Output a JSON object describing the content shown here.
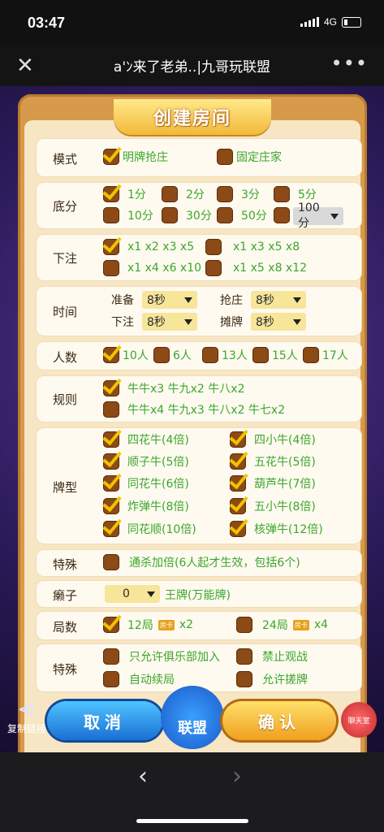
{
  "status": {
    "time": "03:47",
    "network": "4G"
  },
  "nav": {
    "close": "✕",
    "title": "a'ﾝ来了老弟..|九哥玩联盟",
    "more": "•••"
  },
  "dialog_title": "创建房间",
  "mode": {
    "label": "模式",
    "options": [
      {
        "text": "明牌抢庄",
        "checked": true
      },
      {
        "text": "固定庄家",
        "checked": false
      }
    ]
  },
  "base": {
    "label": "底分",
    "options": [
      {
        "text": "1分",
        "checked": true
      },
      {
        "text": "2分",
        "checked": false
      },
      {
        "text": "3分",
        "checked": false
      },
      {
        "text": "5分",
        "checked": false
      },
      {
        "text": "10分",
        "checked": false
      },
      {
        "text": "30分",
        "checked": false
      },
      {
        "text": "50分",
        "checked": false
      }
    ],
    "select": "100分"
  },
  "bet": {
    "label": "下注",
    "options": [
      {
        "text": "x1 x2 x3 x5",
        "checked": true
      },
      {
        "text": "x1 x3 x5 x8",
        "checked": false
      },
      {
        "text": "x1 x4 x6 x10",
        "checked": false
      },
      {
        "text": "x1 x5 x8 x12",
        "checked": false
      }
    ]
  },
  "time": {
    "label": "时间",
    "items": [
      {
        "label": "准备",
        "value": "8秒"
      },
      {
        "label": "抢庄",
        "value": "8秒"
      },
      {
        "label": "下注",
        "value": "8秒"
      },
      {
        "label": "摊牌",
        "value": "8秒"
      }
    ]
  },
  "players": {
    "label": "人数",
    "options": [
      {
        "text": "10人",
        "checked": true
      },
      {
        "text": "6人",
        "checked": false
      },
      {
        "text": "13人",
        "checked": false
      },
      {
        "text": "15人",
        "checked": false
      },
      {
        "text": "17人",
        "checked": false
      }
    ]
  },
  "rules": {
    "label": "规则",
    "options": [
      {
        "text": "牛牛x3 牛九x2 牛八x2",
        "checked": true
      },
      {
        "text": "牛牛x4 牛九x3 牛八x2 牛七x2",
        "checked": false
      }
    ]
  },
  "cards": {
    "label": "牌型",
    "options": [
      {
        "text": "四花牛(4倍)",
        "checked": true
      },
      {
        "text": "四小牛(4倍)",
        "checked": true
      },
      {
        "text": "顺子牛(5倍)",
        "checked": true
      },
      {
        "text": "五花牛(5倍)",
        "checked": true
      },
      {
        "text": "同花牛(6倍)",
        "checked": true
      },
      {
        "text": "葫芦牛(7倍)",
        "checked": true
      },
      {
        "text": "炸弹牛(8倍)",
        "checked": true
      },
      {
        "text": "五小牛(8倍)",
        "checked": true
      },
      {
        "text": "同花顺(10倍)",
        "checked": true
      },
      {
        "text": "核弹牛(12倍)",
        "checked": true
      }
    ]
  },
  "special": {
    "label": "特殊",
    "option": {
      "text": "通杀加倍(6人起才生效，包括6个)",
      "checked": false
    }
  },
  "wild": {
    "label": "癞子",
    "select": "0",
    "text": "王牌(万能牌)"
  },
  "rounds": {
    "label": "局数",
    "options": [
      {
        "text": "12局",
        "badge": "房卡",
        "mult": "x2",
        "checked": true
      },
      {
        "text": "24局",
        "badge": "房卡",
        "mult": "x4",
        "checked": false
      }
    ]
  },
  "special2": {
    "label": "特殊",
    "options": [
      {
        "text": "只允许俱乐部加入",
        "checked": false
      },
      {
        "text": "禁止观战",
        "checked": false
      },
      {
        "text": "自动续局",
        "checked": false
      },
      {
        "text": "允许搓牌",
        "checked": false
      }
    ]
  },
  "buttons": {
    "cancel": "取消",
    "ok": "确认",
    "league": "联盟",
    "share": "复制链接",
    "chat": "聊天室"
  }
}
